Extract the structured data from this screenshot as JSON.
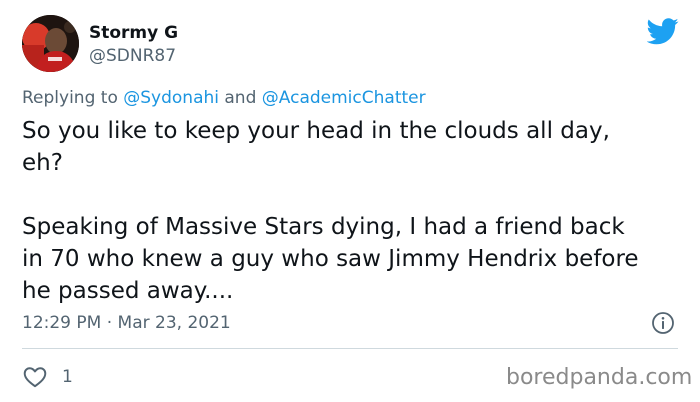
{
  "author": {
    "display_name": "Stormy G",
    "handle": "@SDNR87"
  },
  "reply": {
    "prefix": "Replying to ",
    "mention_1": "@Sydonahi",
    "joiner": " and ",
    "mention_2": "@AcademicChatter"
  },
  "tweet": {
    "line_1": "So you like to keep your head in the clouds all day,",
    "line_2": "eh?",
    "line_3": "Speaking of Massive Stars dying, I had a friend  back",
    "line_4": "in 70 who knew a guy who saw Jimmy Hendrix before",
    "line_5": "he passed away...."
  },
  "meta": {
    "timestamp": "12:29 PM · Mar 23, 2021"
  },
  "actions": {
    "like_count": "1"
  },
  "watermark": "boredpanda.com",
  "icons": {
    "brand": "twitter-bird-icon",
    "info": "info-icon",
    "like": "heart-icon"
  },
  "colors": {
    "twitter_blue": "#1da1f2",
    "mention_blue": "#1b95e0",
    "secondary_text": "#536471",
    "divider": "#cfd9de"
  }
}
